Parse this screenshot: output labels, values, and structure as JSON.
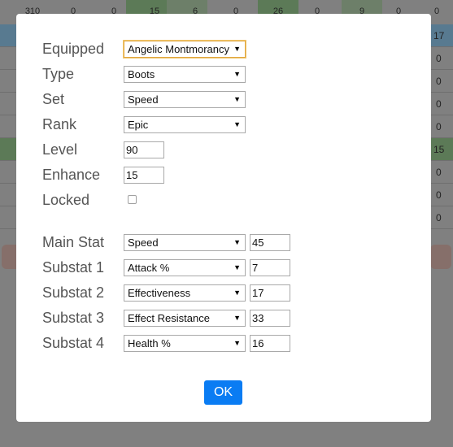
{
  "background_table": {
    "top_row": [
      "310",
      "0",
      "0",
      "15",
      "6",
      "0",
      "26",
      "0",
      "9",
      "0",
      "0"
    ],
    "right_values": [
      "17",
      "0",
      "0",
      "0",
      "0",
      "0",
      "15",
      "0",
      "0",
      "0"
    ]
  },
  "dialog": {
    "equipped": {
      "label": "Equipped",
      "value": "Angelic Montmorancy"
    },
    "type": {
      "label": "Type",
      "value": "Boots"
    },
    "set": {
      "label": "Set",
      "value": "Speed"
    },
    "rank": {
      "label": "Rank",
      "value": "Epic"
    },
    "level": {
      "label": "Level",
      "value": "90"
    },
    "enhance": {
      "label": "Enhance",
      "value": "15"
    },
    "locked": {
      "label": "Locked",
      "checked": false
    },
    "main_stat": {
      "label": "Main Stat",
      "stat": "Speed",
      "value": "45"
    },
    "substats": [
      {
        "label": "Substat 1",
        "stat": "Attack %",
        "value": "7"
      },
      {
        "label": "Substat 2",
        "stat": "Effectiveness",
        "value": "17"
      },
      {
        "label": "Substat 3",
        "stat": "Effect Resistance",
        "value": "33"
      },
      {
        "label": "Substat 4",
        "stat": "Health %",
        "value": "16"
      }
    ],
    "ok_label": "OK"
  },
  "icons": {
    "dropdown_arrow": "▼"
  }
}
